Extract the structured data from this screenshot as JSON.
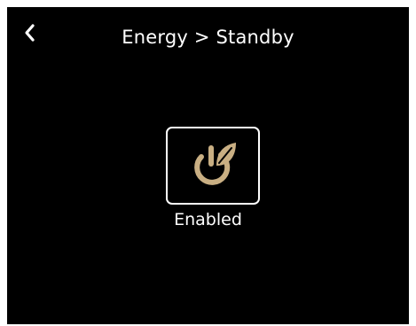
{
  "header": {
    "title": "Energy > Standby",
    "back_icon": "chevron-left-icon"
  },
  "standby": {
    "icon": "power-leaf-icon",
    "status": "Enabled",
    "icon_color": "#C9AF83"
  },
  "colors": {
    "background": "#000000",
    "text": "#FFFFFF",
    "accent": "#C9AF83"
  }
}
